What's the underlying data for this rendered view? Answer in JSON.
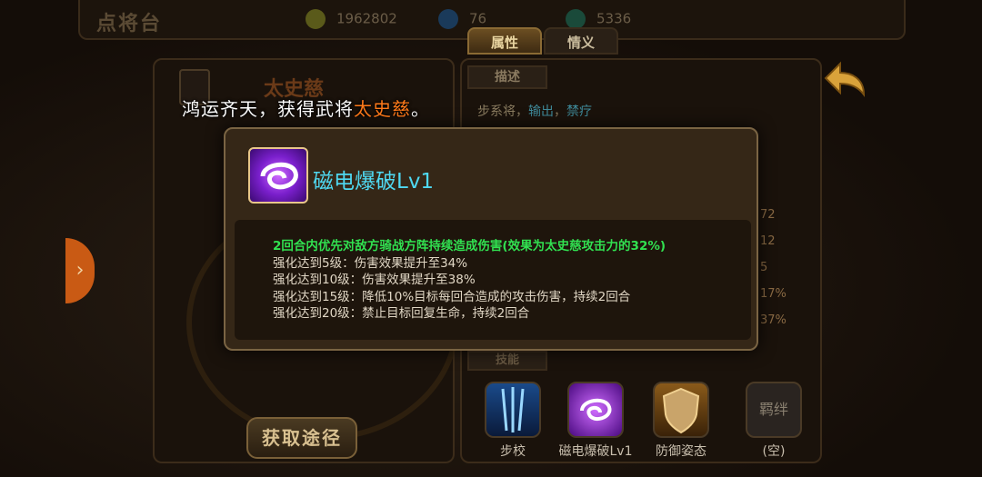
{
  "topbar": {
    "title": "点将台",
    "resources": [
      {
        "name": "gold-icon",
        "value": "1962802"
      },
      {
        "name": "gem-icon",
        "value": "76"
      },
      {
        "name": "food-icon",
        "value": "5336"
      }
    ]
  },
  "tabs": {
    "attributes": "属性",
    "bonds": "情义"
  },
  "hero": {
    "name": "太史慈",
    "obtain_button": "获取途径"
  },
  "description": {
    "tab": "描述",
    "text_prefix": "步系将，",
    "role1": "输出",
    "role2": "禁疗"
  },
  "stats": [
    "72",
    "12",
    "5",
    "17%",
    "37%"
  ],
  "skills": {
    "tab": "技能",
    "items": [
      {
        "label": "步校",
        "icon": "sword-rain-icon"
      },
      {
        "label": "磁电爆破Lv1",
        "icon": "vortex-icon"
      },
      {
        "label": "防御姿态",
        "icon": "shield-icon"
      },
      {
        "label": "(空)",
        "icon": "bond-empty-icon",
        "slot_text": "羁绊"
      }
    ]
  },
  "notice": {
    "prefix": "鸿运齐天，获得武将",
    "hero": "太史慈",
    "suffix": "。"
  },
  "tooltip": {
    "skill_name": "磁电爆破Lv1",
    "main_effect": "2回合内优先对敌方骑战方阵持续造成伤害(效果为太史慈攻击力的32%)",
    "upgrades": [
      "强化达到5级：伤害效果提升至34%",
      "强化达到10级：伤害效果提升至38%",
      "强化达到15级：降低10%目标每回合造成的攻击伤害，持续2回合",
      "强化达到20级：禁止目标回复生命，持续2回合"
    ]
  },
  "colors": {
    "accent_cyan": "#4fd9f2",
    "effect_green": "#31e050",
    "hero_orange": "#ff7a1a"
  }
}
